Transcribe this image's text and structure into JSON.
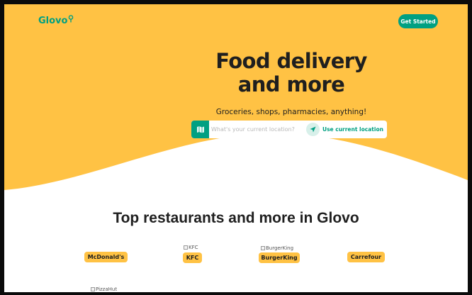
{
  "header": {
    "logo_text": "Glovo",
    "cta_label": "Get Started"
  },
  "hero": {
    "headline": "Food delivery and more",
    "subheadline": "Groceries, shops, pharmacies, anything!",
    "search": {
      "placeholder": "What's your current location?",
      "use_location_label": "Use current location"
    }
  },
  "restaurants": {
    "title": "Top restaurants and more in Glovo",
    "items": [
      {
        "label": "McDonald's",
        "image_alt": ""
      },
      {
        "label": "KFC",
        "image_alt": "KFC"
      },
      {
        "label": "BurgerKing",
        "image_alt": "BurgerKing"
      },
      {
        "label": "Carrefour",
        "image_alt": ""
      },
      {
        "label": "",
        "image_alt": "PizzaHut"
      }
    ]
  },
  "colors": {
    "brand_yellow": "#ffc244",
    "brand_green": "#00a082",
    "text_dark": "#1f1f1f",
    "page_frame": "#0b0b0b"
  },
  "icons": {
    "logo_pin": "location-pin-icon",
    "map": "map-icon",
    "locate": "navigation-arrow-icon",
    "broken_image": "broken-image-icon"
  }
}
